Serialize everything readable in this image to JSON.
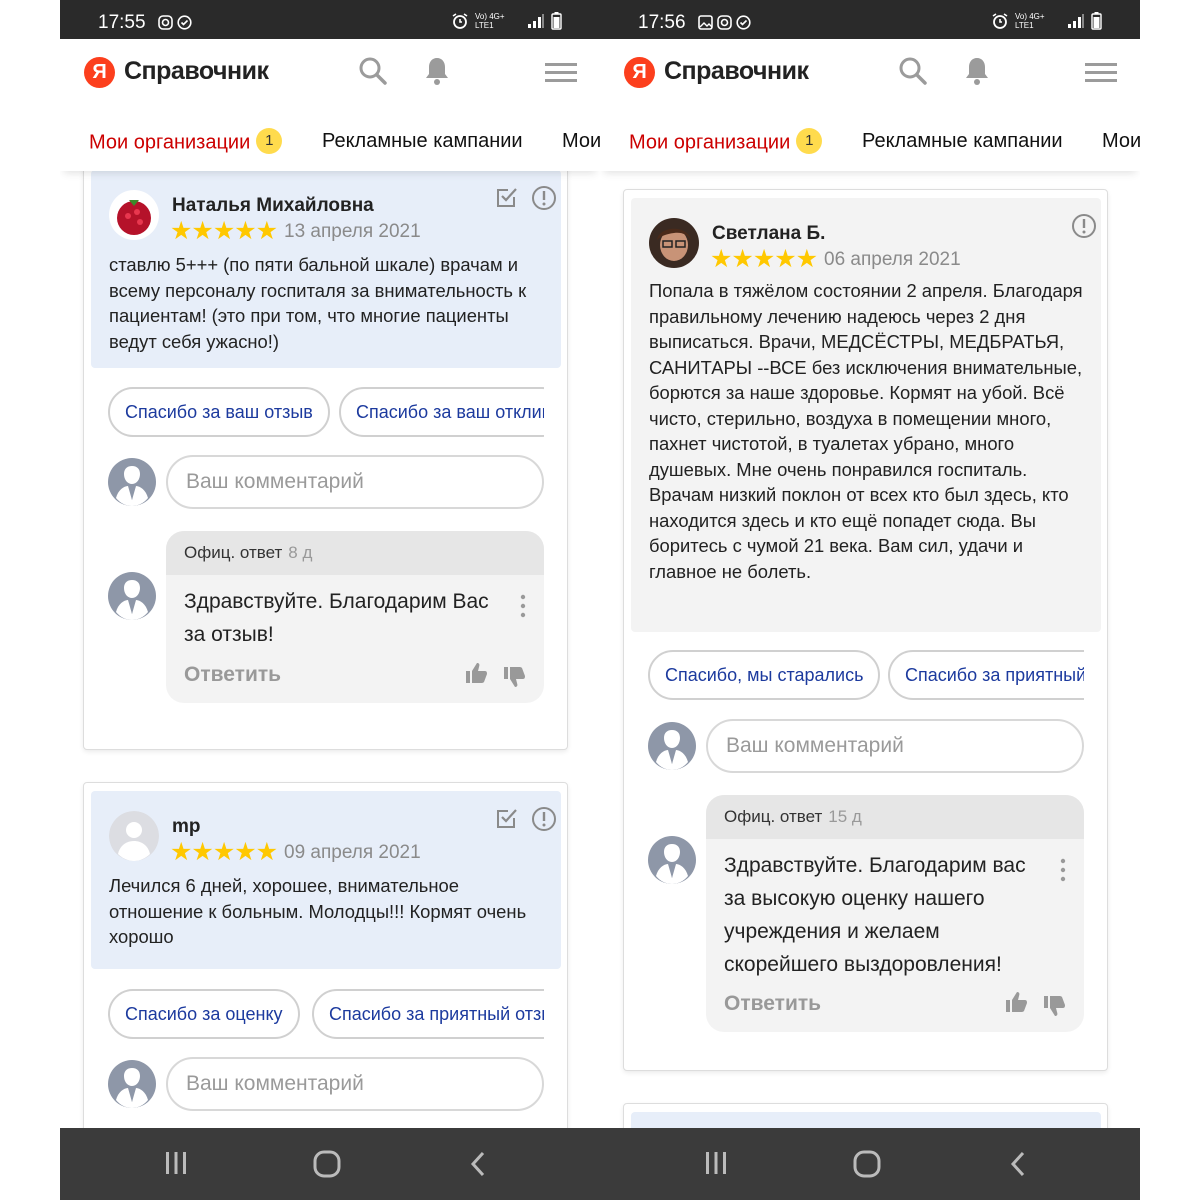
{
  "left": {
    "status": {
      "time": "17:55",
      "network": "Vo) 4G+ LTE1"
    },
    "app": {
      "logo_letter": "Я",
      "logo_text": "Справочник"
    },
    "tabs": [
      {
        "label": "Мои организации",
        "badge": "1"
      },
      {
        "label": "Рекламные кампании"
      },
      {
        "label": "Мои"
      }
    ],
    "reviews": [
      {
        "author": "Наталья Михайловна",
        "stars": "★★★★★",
        "rating": 5,
        "date": "13 апреля 2021",
        "text": "ставлю 5+++ (по пяти бальной шкале) врачам и всему персоналу госпиталя за внимательность к пациентам! (это при том, что многие пациенты ведут себя ужасно!)",
        "quick_replies": [
          "Спасибо за ваш отзыв",
          "Спасибо за ваш отклик"
        ],
        "comment_placeholder": "Ваш комментарий",
        "official": {
          "label": "Офиц. ответ",
          "age": "8 д",
          "text": "Здравствуйте. Благодарим Вас за отзыв!",
          "reply": "Ответить"
        }
      },
      {
        "author": "mp",
        "stars": "★★★★★",
        "rating": 5,
        "date": "09 апреля 2021",
        "text": "Лечился 6 дней, хорошее, внимательное отношение к больным. Молодцы!!! Кормят очень хорошо",
        "quick_replies": [
          "Спасибо за оценку",
          "Спасибо за приятный отзыв"
        ],
        "comment_placeholder": "Ваш комментарий"
      }
    ]
  },
  "right": {
    "status": {
      "time": "17:56",
      "network": "Vo) 4G+ LTE1"
    },
    "app": {
      "logo_letter": "Я",
      "logo_text": "Справочник"
    },
    "tabs": [
      {
        "label": "Мои организации",
        "badge": "1"
      },
      {
        "label": "Рекламные кампании"
      },
      {
        "label": "Мои"
      }
    ],
    "reviews": [
      {
        "author": "Светлана Б.",
        "stars": "★★★★★",
        "rating": 5,
        "date": "06 апреля 2021",
        "text": "Попала в тяжёлом состоянии 2 апреля. Благодаря правильному лечению надеюсь через 2 дня выписаться. Врачи, МЕДСЁСТРЫ, МЕДБРАТЬЯ, САНИТАРЫ --ВСЕ без исключения внимательные, борются за наше здоровье. Кормят на убой. Всё чисто, стерильно, воздуха в помещении много, пахнет чистотой, в туалетах убрано, много душевых. Мне очень понравился госпиталь. Врачам низкий поклон от всех кто был здесь, кто находится здесь и кто ещё попадет сюда. Вы боритесь с чумой 21 века. Вам сил, удачи и главное не болеть.",
        "quick_replies": [
          "Спасибо, мы старались",
          "Спасибо за приятный отзыв"
        ],
        "comment_placeholder": "Ваш комментарий",
        "official": {
          "label": "Офиц. ответ",
          "age": "15 д",
          "text": "Здравствуйте. Благодарим вас за высокую оценку нашего учреждения и желаем скорейшего выздоровления!",
          "reply": "Ответить"
        }
      }
    ]
  },
  "colors": {
    "active_tab": "#cc0000",
    "badge": "#ffdb4d",
    "logo": "#fc3f1d",
    "star": "#ffc800",
    "chip_text": "#1c3a9e",
    "review_bg": "#e7eef9",
    "status_bar": "#2a2a2a",
    "nav_bar": "#3b3b3b"
  },
  "icons": [
    "search-icon",
    "bell-icon",
    "menu-icon",
    "edit-check-icon",
    "complaint-icon",
    "more-vertical-icon",
    "thumb-up-icon",
    "thumb-down-icon",
    "recent-apps-icon",
    "home-icon",
    "back-icon"
  ]
}
